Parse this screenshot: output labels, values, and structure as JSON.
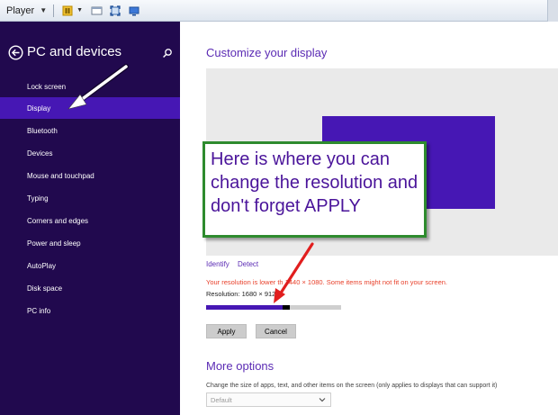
{
  "toolbar": {
    "title": "Player",
    "icons": [
      "pause-icon",
      "window-icon",
      "fullscreen-icon",
      "display-icon"
    ]
  },
  "sidebar": {
    "title": "PC and devices",
    "active_item": "Display",
    "items": [
      {
        "label": "Lock screen"
      },
      {
        "label": "Display"
      },
      {
        "label": "Bluetooth"
      },
      {
        "label": "Devices"
      },
      {
        "label": "Mouse and touchpad"
      },
      {
        "label": "Typing"
      },
      {
        "label": "Corners and edges"
      },
      {
        "label": "Power and sleep"
      },
      {
        "label": "AutoPlay"
      },
      {
        "label": "Disk space"
      },
      {
        "label": "PC info"
      }
    ]
  },
  "main": {
    "title": "Customize your display",
    "identify_link": "Identify",
    "detect_link": "Detect",
    "warning": "Your resolution is lower th   1440 × 1080. Some items might not fit on your screen.",
    "resolution": "Resolution: 1680 × 912",
    "slider_value": 0.6,
    "apply_label": "Apply",
    "cancel_label": "Cancel",
    "more_options_title": "More options",
    "more_options_desc": "Change the size of apps, text, and other items on the screen (only applies to displays that can support it)",
    "size_dropdown": "Default"
  },
  "annotation": {
    "text": "Here is where you can change the resolution and don't forget APPLY"
  },
  "colors": {
    "sidebar_bg": "#21094e",
    "accent": "#4617b4",
    "warning": "#e8412b",
    "annotation_border": "#2e8b2e",
    "arrow_red": "#e11e1e"
  }
}
